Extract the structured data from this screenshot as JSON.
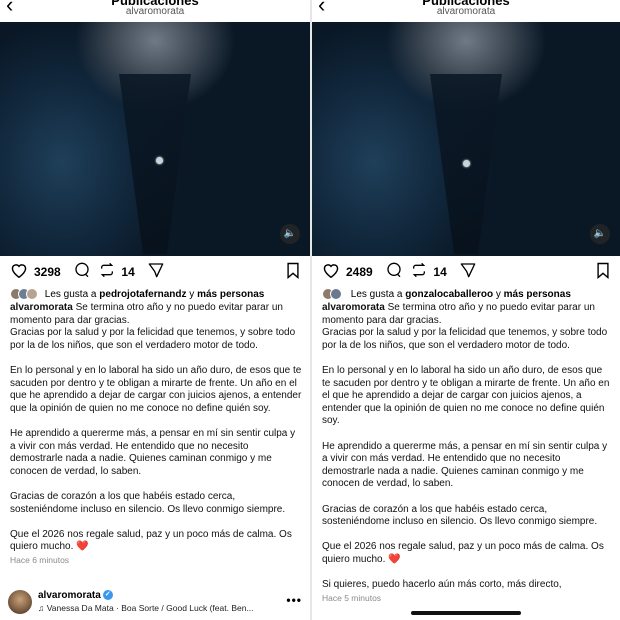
{
  "left": {
    "header": {
      "title": "Publicaciones",
      "username": "alvaromorata"
    },
    "actions": {
      "likes": "3298",
      "reposts": "14"
    },
    "likes_line": {
      "prefix": "Les gusta a",
      "user": "pedrojotafernandz",
      "connector": "y",
      "rest": "más personas"
    },
    "caption": {
      "author": "alvaromorata",
      "p1": "Se termina otro año y no puedo evitar parar un momento para dar gracias.",
      "p1b": "Gracias por la salud y por la felicidad que tenemos, y sobre todo por la de los niños, que son el verdadero motor de todo.",
      "p2": "En lo personal y en lo laboral ha sido un año duro, de esos que te sacuden por dentro y te obligan a mirarte de frente. Un año en el que he aprendido a dejar de cargar con juicios ajenos, a entender que la opinión de quien no me conoce no define quién soy.",
      "p3": "He aprendido a quererme más, a pensar en mí sin sentir culpa y a vivir con más verdad. He entendido que no necesito demostrarle nada a nadie. Quienes caminan conmigo y me conocen de verdad, lo saben.",
      "p4": "Gracias de corazón a los que habéis estado cerca, sosteniéndome incluso en silencio. Os llevo conmigo siempre.",
      "p5": "Que el 2026 nos regale salud, paz y un poco más de calma. Os quiero mucho.",
      "heart": "❤️"
    },
    "timestamp": "Hace 6 minutos",
    "music": {
      "user": "alvaromorata",
      "song": "Vanessa Da Mata · Boa Sorte / Good Luck (feat. Ben...",
      "more": "•••"
    }
  },
  "right": {
    "header": {
      "title": "Publicaciones",
      "username": "alvaromorata"
    },
    "actions": {
      "likes": "2489",
      "reposts": "14"
    },
    "likes_line": {
      "prefix": "Les gusta a",
      "user": "gonzalocaballeroo",
      "connector": "y",
      "rest": "más personas"
    },
    "caption": {
      "author": "alvaromorata",
      "p1": "Se termina otro año y no puedo evitar parar un momento para dar gracias.",
      "p1b": "Gracias por la salud y por la felicidad que tenemos, y sobre todo por la de los niños, que son el verdadero motor de todo.",
      "p2": "En lo personal y en lo laboral ha sido un año duro, de esos que te sacuden por dentro y te obligan a mirarte de frente. Un año en el que he aprendido a dejar de cargar con juicios ajenos, a entender que la opinión de quien no me conoce no define quién soy.",
      "p3": "He aprendido a quererme más, a pensar en mí sin sentir culpa y a vivir con más verdad. He entendido que no necesito demostrarle nada a nadie. Quienes caminan conmigo y me conocen de verdad, lo saben.",
      "p4": "Gracias de corazón a los que habéis estado cerca, sosteniéndome incluso en silencio. Os llevo conmigo siempre.",
      "p5": "Que el 2026 nos regale salud, paz y un poco más de calma. Os quiero mucho.",
      "heart": "❤️",
      "p6": "Si quieres, puedo hacerlo aún más corto, más directo,"
    },
    "timestamp": "Hace 5 minutos"
  },
  "icons": {
    "back": "back-chevron-icon",
    "like": "heart-outline-icon",
    "comment": "comment-bubble-icon",
    "repost": "repost-arrows-icon",
    "share": "send-paper-plane-icon",
    "save": "bookmark-icon",
    "volume": "speaker-icon",
    "music": "music-note-icon",
    "verified": "verified-badge-icon"
  },
  "colors": {
    "heart": "#e0245e",
    "verified": "#3897f0",
    "timestamp": "#8a8a8a"
  }
}
